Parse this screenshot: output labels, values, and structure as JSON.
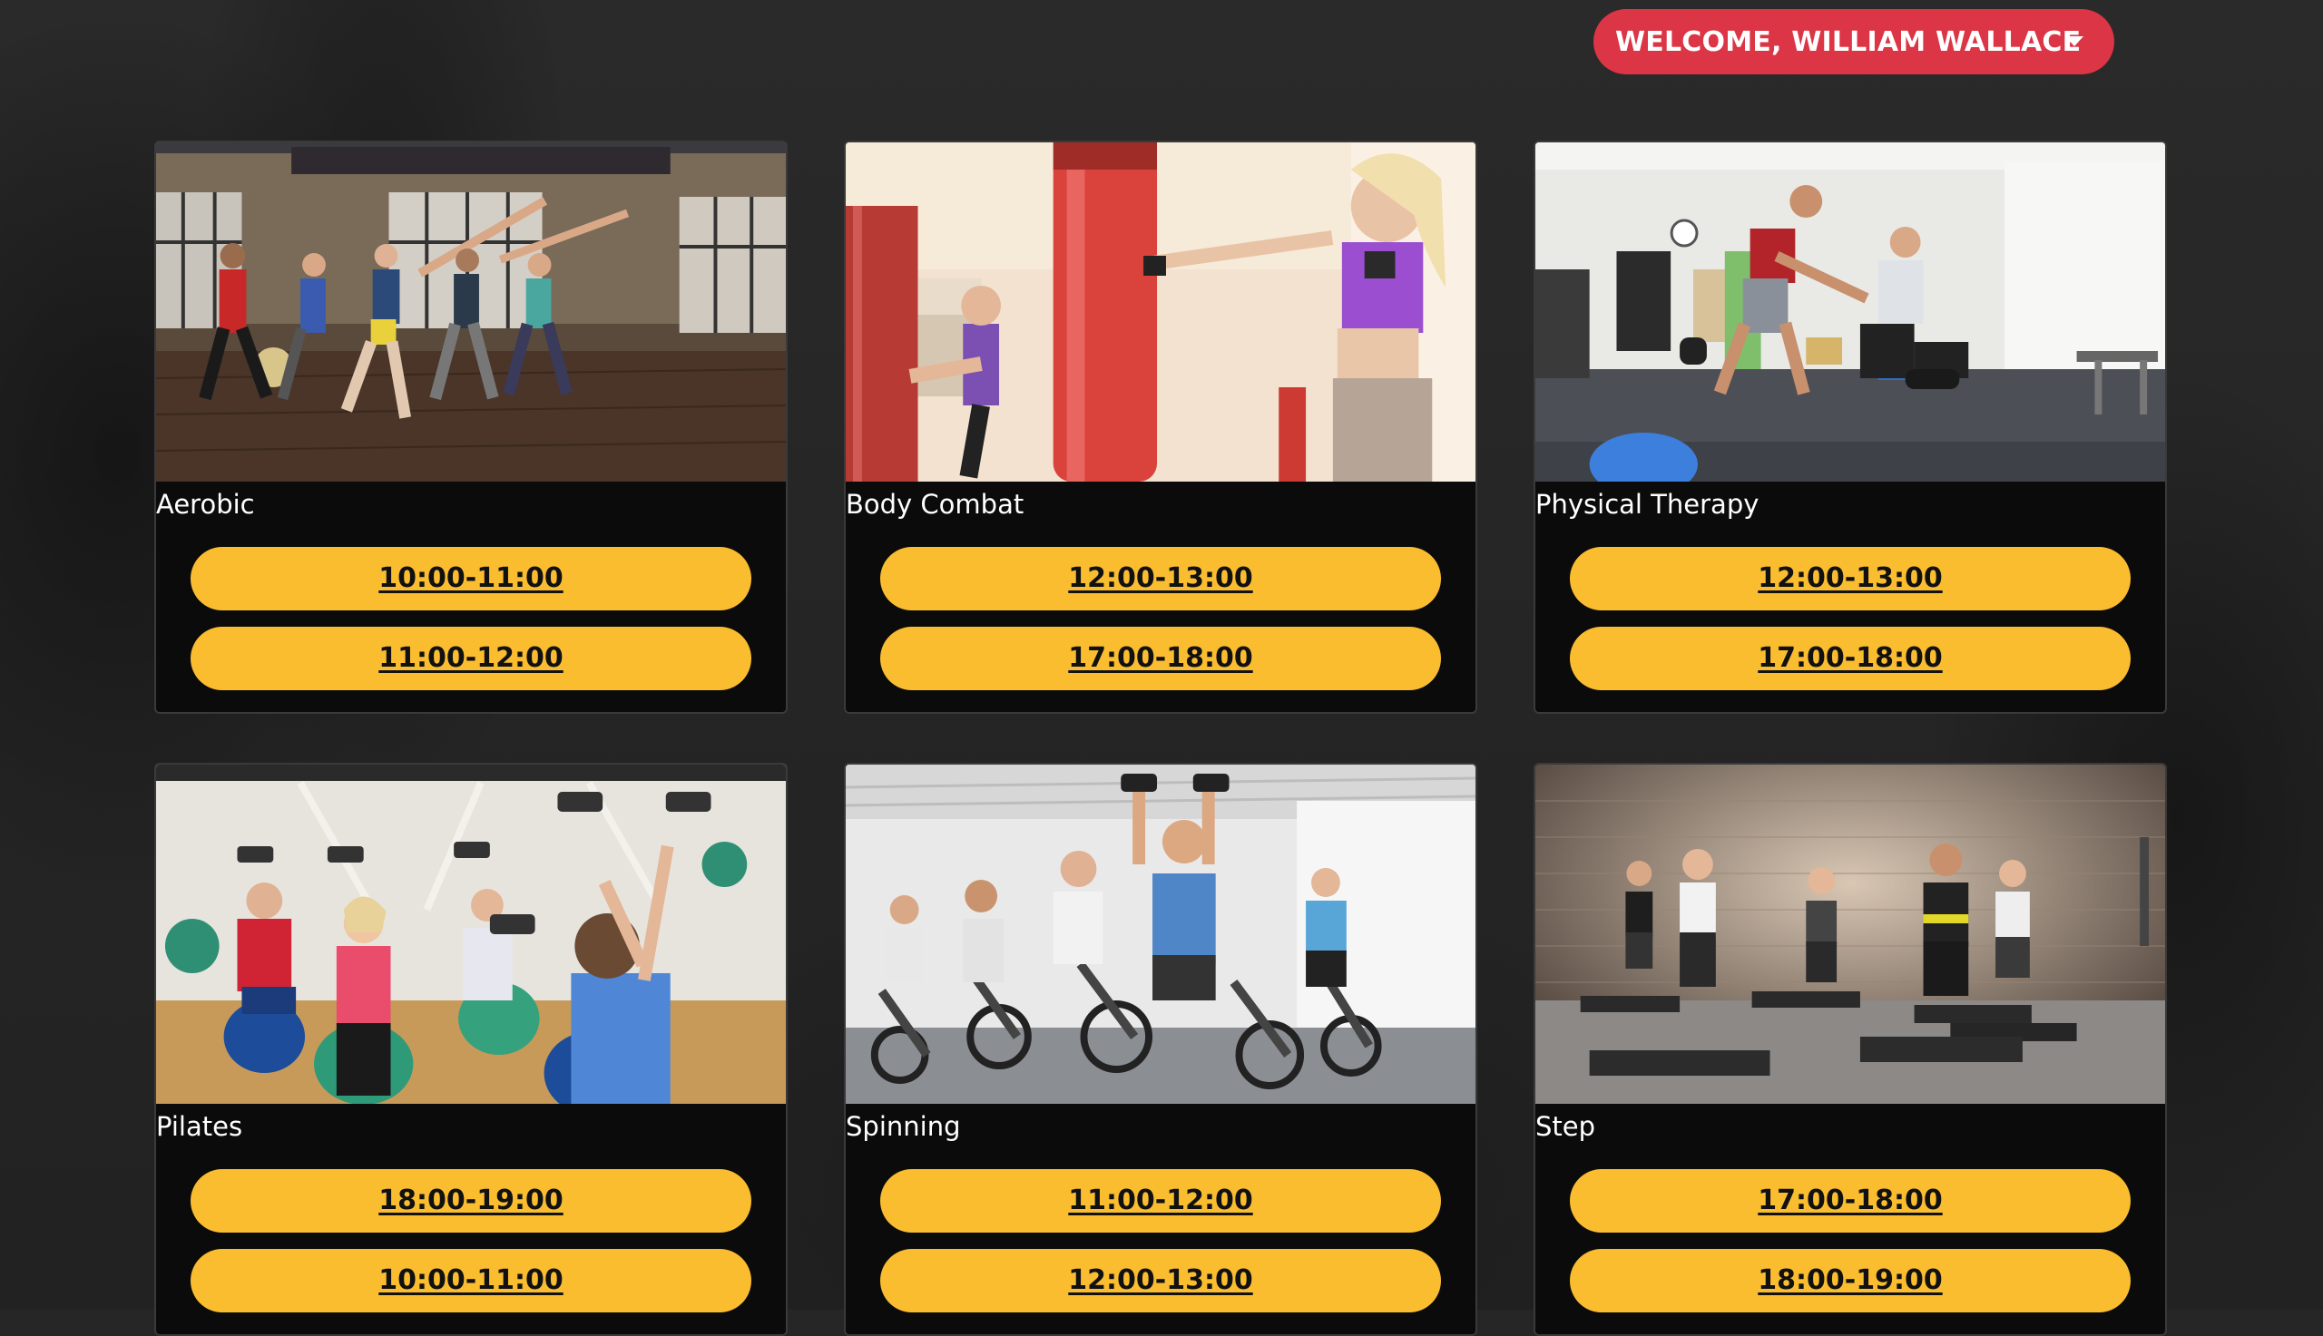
{
  "header": {
    "welcome_label": "WELCOME, WILLIAM WALLACE",
    "welcome_color": "#dc3545"
  },
  "accent_color": "#fbbd30",
  "classes": [
    {
      "title": "Aerobic",
      "photo": "aerobic-class-photo",
      "slots": [
        "10:00-11:00",
        "11:00-12:00"
      ]
    },
    {
      "title": "Body Combat",
      "photo": "body-combat-class-photo",
      "slots": [
        "12:00-13:00",
        "17:00-18:00"
      ]
    },
    {
      "title": "Physical Therapy",
      "photo": "physical-therapy-class-photo",
      "slots": [
        "12:00-13:00",
        "17:00-18:00"
      ]
    },
    {
      "title": "Pilates",
      "photo": "pilates-class-photo",
      "slots": [
        "18:00-19:00",
        "10:00-11:00"
      ]
    },
    {
      "title": "Spinning",
      "photo": "spinning-class-photo",
      "slots": [
        "11:00-12:00",
        "12:00-13:00"
      ]
    },
    {
      "title": "Step",
      "photo": "step-class-photo",
      "slots": [
        "17:00-18:00",
        "18:00-19:00"
      ]
    }
  ]
}
